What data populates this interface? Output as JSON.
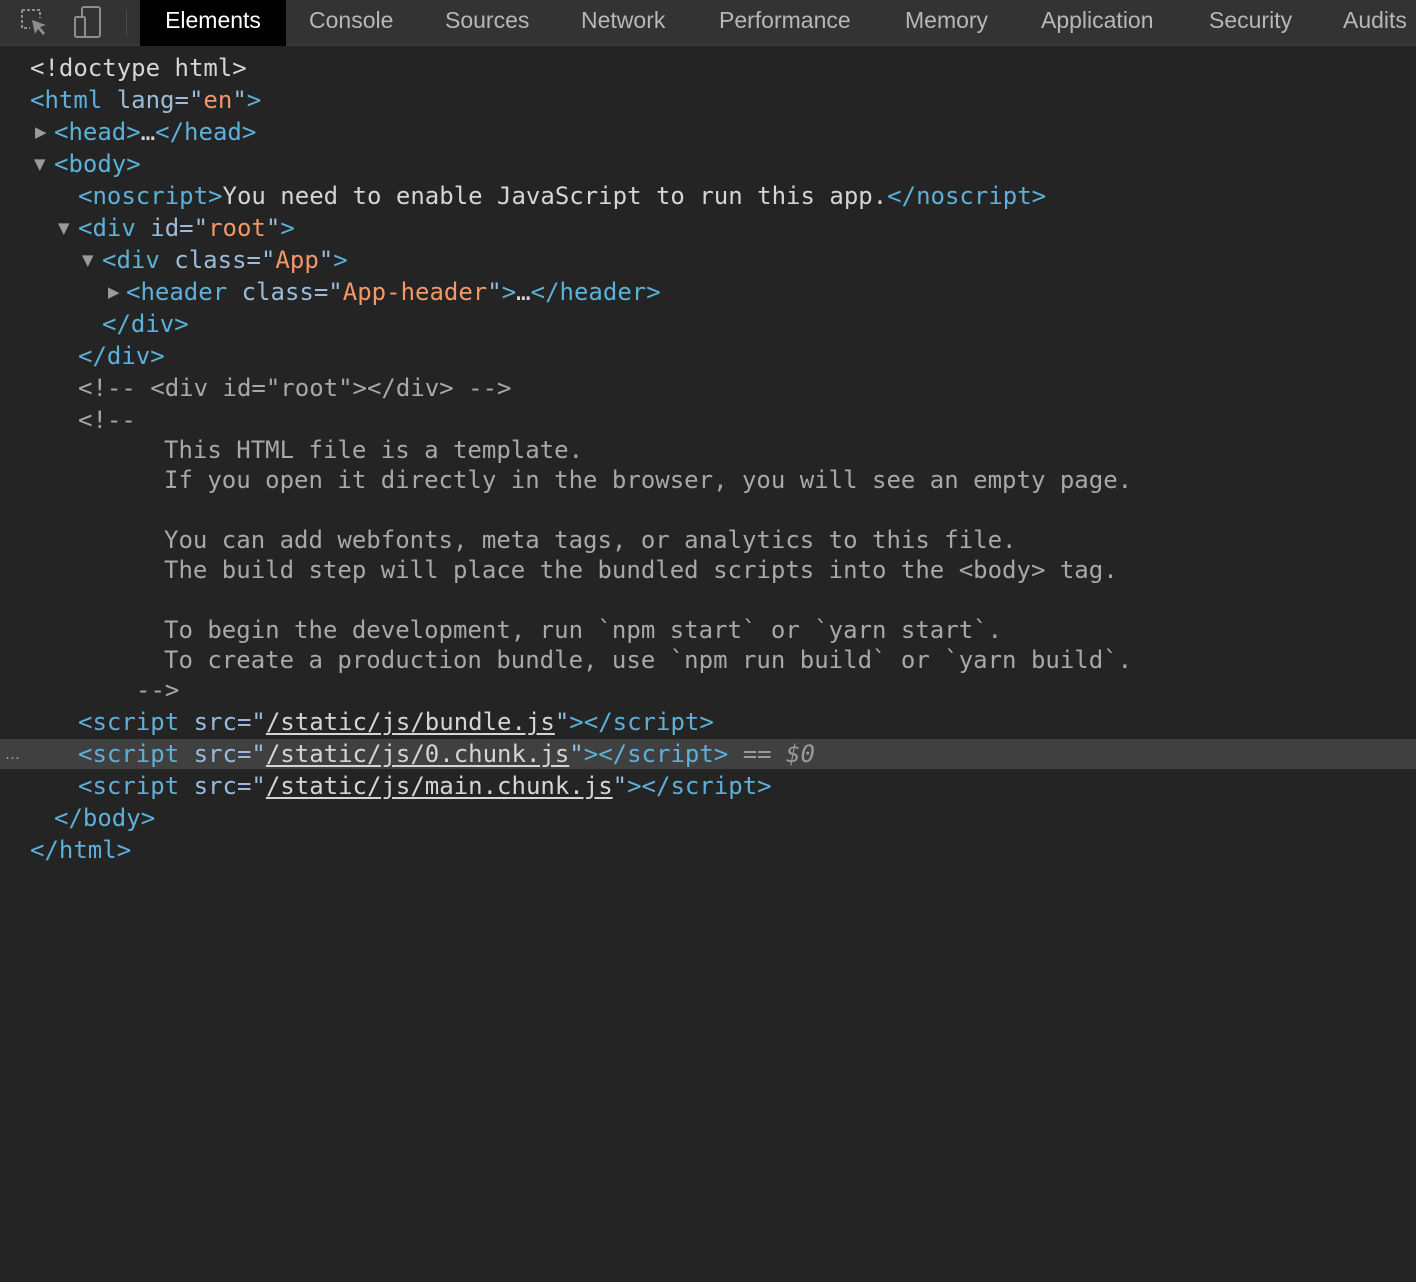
{
  "toolbar": {
    "icons": [
      "inspect-element-icon",
      "device-toolbar-icon"
    ],
    "tabs": [
      {
        "label": "Elements",
        "active": true
      },
      {
        "label": "Console",
        "active": false
      },
      {
        "label": "Sources",
        "active": false
      },
      {
        "label": "Network",
        "active": false
      },
      {
        "label": "Performance",
        "active": false
      },
      {
        "label": "Memory",
        "active": false
      },
      {
        "label": "Application",
        "active": false
      },
      {
        "label": "Security",
        "active": false
      },
      {
        "label": "Audits",
        "active": false
      }
    ]
  },
  "dom": {
    "doctype": "<!doctype html>",
    "html": {
      "tag": "html",
      "attr": "lang",
      "value": "en"
    },
    "head": {
      "open": "<head>",
      "ellipsis": "…",
      "close": "</head>",
      "expanded": false
    },
    "body": {
      "open": "<body>",
      "close": "</body>",
      "expanded": true
    },
    "noscript": {
      "open": "<noscript>",
      "text": "You need to enable JavaScript to run this app.",
      "close": "</noscript>"
    },
    "root_div": {
      "tag": "div",
      "attr": "id",
      "value": "root",
      "close": "</div>",
      "expanded": true
    },
    "app_div": {
      "tag": "div",
      "attr": "class",
      "value": "App",
      "close": "</div>",
      "expanded": true
    },
    "header": {
      "tag": "header",
      "attr": "class",
      "value": "App-header",
      "ellipsis": "…",
      "close": "</header>",
      "expanded": false
    },
    "comment_inline": "<!-- <div id=\"root\"></div> -->",
    "comment_block": {
      "open": "<!--",
      "lines": [
        "This HTML file is a template.",
        "If you open it directly in the browser, you will see an empty page.",
        "",
        "You can add webfonts, meta tags, or analytics to this file.",
        "The build step will place the bundled scripts into the <body> tag.",
        "",
        "To begin the development, run `npm start` or `yarn start`.",
        "To create a production bundle, use `npm run build` or `yarn build`."
      ],
      "close": "-->"
    },
    "scripts": [
      {
        "src": "/static/js/bundle.js",
        "selected": false
      },
      {
        "src": "/static/js/0.chunk.js",
        "selected": true
      },
      {
        "src": "/static/js/main.chunk.js",
        "selected": false
      }
    ],
    "selected_marker": "== $0",
    "row_menu": "…",
    "html_close": "</html>"
  }
}
